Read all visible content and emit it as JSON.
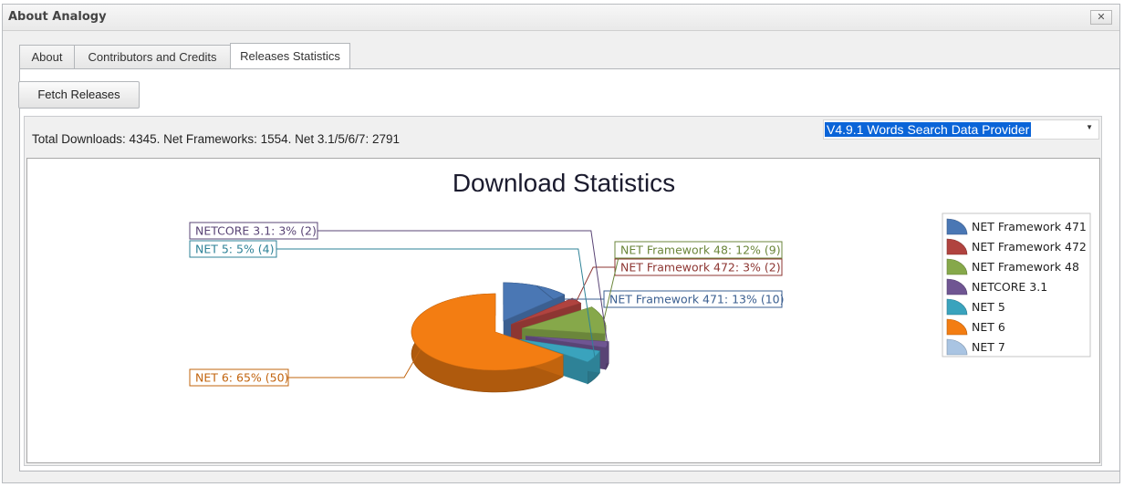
{
  "window": {
    "title": "About Analogy",
    "close_glyph": "✕"
  },
  "tabs": [
    {
      "label": "About"
    },
    {
      "label": "Contributors and Credits"
    },
    {
      "label": "Releases Statistics",
      "active": true
    }
  ],
  "toolbar": {
    "fetch_label": "Fetch Releases"
  },
  "summary": "Total Downloads: 4345. Net Frameworks: 1554. Net 3.1/5/6/7: 2791",
  "provider_select": {
    "value": "V4.9.1 Words Search Data Provider",
    "arrow_icon": "dropdown-arrow-icon"
  },
  "chart_data": {
    "type": "pie",
    "title": "Download Statistics",
    "legend_position": "right",
    "series": [
      {
        "name": "NET Framework 471",
        "value": 10,
        "percent": 13,
        "label": "NET Framework 471: 13% (10)",
        "color": "#4a77b4"
      },
      {
        "name": "NET Framework 472",
        "value": 2,
        "percent": 3,
        "label": "NET Framework 472: 3% (2)",
        "color": "#b0433f"
      },
      {
        "name": "NET Framework 48",
        "value": 9,
        "percent": 12,
        "label": "NET Framework 48: 12% (9)",
        "color": "#86a84a"
      },
      {
        "name": "NETCORE 3.1",
        "value": 2,
        "percent": 3,
        "label": "NETCORE 3.1: 3% (2)",
        "color": "#6f5592"
      },
      {
        "name": "NET 5",
        "value": 4,
        "percent": 5,
        "label": "NET 5: 5% (4)",
        "color": "#3aa3bd"
      },
      {
        "name": "NET 6",
        "value": 50,
        "percent": 65,
        "label": "NET 6: 65% (50)",
        "color": "#f37d12"
      },
      {
        "name": "NET 7",
        "value": 0,
        "percent": 0,
        "label": "",
        "color": "#a9c4e2"
      }
    ]
  }
}
